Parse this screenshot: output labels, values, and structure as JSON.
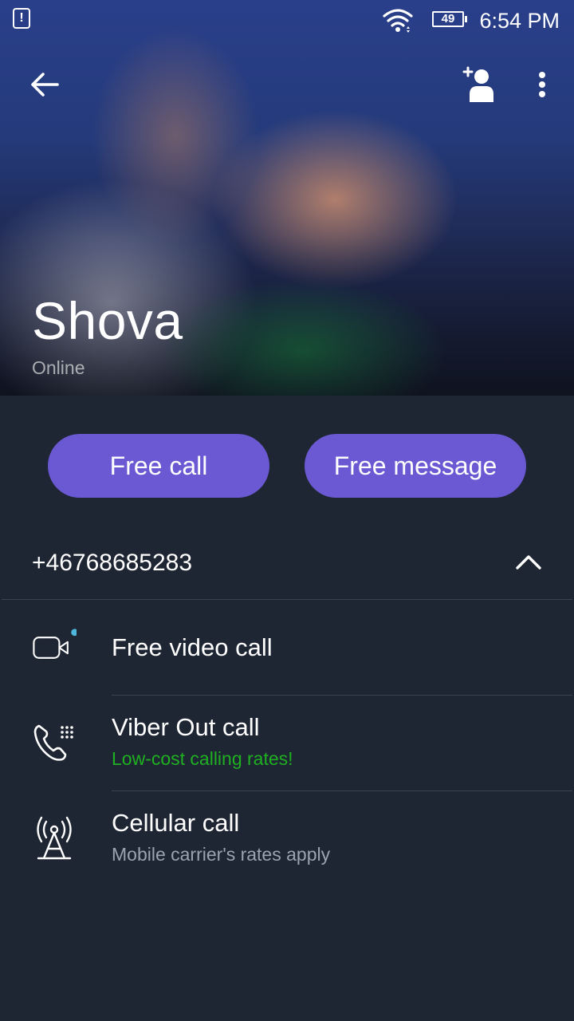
{
  "status_bar": {
    "alert_glyph": "!",
    "battery_level": "49",
    "time": "6:54 PM",
    "icons": [
      "sim-alert-icon",
      "wifi-icon",
      "battery-icon"
    ]
  },
  "header": {
    "back_icon": "back-arrow-icon",
    "add_contact_icon": "add-contact-icon",
    "menu_icon": "more-vert-icon",
    "contact_name": "Shova",
    "contact_status": "Online"
  },
  "actions": {
    "free_call_label": "Free call",
    "free_message_label": "Free message"
  },
  "phone": {
    "number": "+46768685283",
    "toggle_icon": "chevron-up-icon"
  },
  "options": [
    {
      "title": "Free video call",
      "subtitle": "",
      "icon": "video-camera-icon"
    },
    {
      "title": "Viber Out call",
      "subtitle": "Low-cost calling rates!",
      "icon": "phone-dial-icon"
    },
    {
      "title": "Cellular call",
      "subtitle": "Mobile carrier's rates apply",
      "icon": "cell-tower-icon"
    }
  ],
  "colors": {
    "background": "#1f2633",
    "accent": "#6b58d3",
    "promo_green": "#1fb021",
    "notice_dot": "#4fb6dc"
  }
}
